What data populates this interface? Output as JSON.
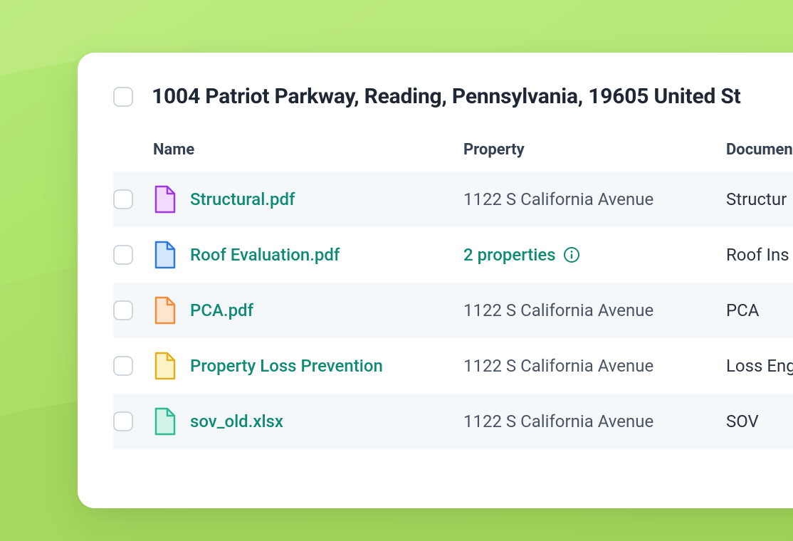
{
  "header": {
    "title": "1004 Patriot Parkway, Reading, Pennsylvania, 19605 United St"
  },
  "columns": {
    "name": "Name",
    "property": "Property",
    "document": "Documen"
  },
  "rows": [
    {
      "filename": "Structural.pdf",
      "property": "1122 S California Avenue",
      "document": "Structur",
      "iconColor": {
        "fill": "#f2dafc",
        "stroke": "#a038e0"
      },
      "propertyLink": false
    },
    {
      "filename": "Roof Evaluation.pdf",
      "property": "2 properties",
      "document": "Roof Ins",
      "iconColor": {
        "fill": "#d5e8fb",
        "stroke": "#2d7ad6"
      },
      "propertyLink": true
    },
    {
      "filename": "PCA.pdf",
      "property": "1122 S California Avenue",
      "document": "PCA",
      "iconColor": {
        "fill": "#fde5cf",
        "stroke": "#f08c3a"
      },
      "propertyLink": false
    },
    {
      "filename": "Property Loss Prevention",
      "property": "1122 S California Avenue",
      "document": "Loss Eng",
      "iconColor": {
        "fill": "#fcf3c5",
        "stroke": "#e0b020"
      },
      "propertyLink": false
    },
    {
      "filename": "sov_old.xlsx",
      "property": "1122 S California Avenue",
      "document": "SOV",
      "iconColor": {
        "fill": "#d2f3e8",
        "stroke": "#2fb894"
      },
      "propertyLink": false
    }
  ]
}
